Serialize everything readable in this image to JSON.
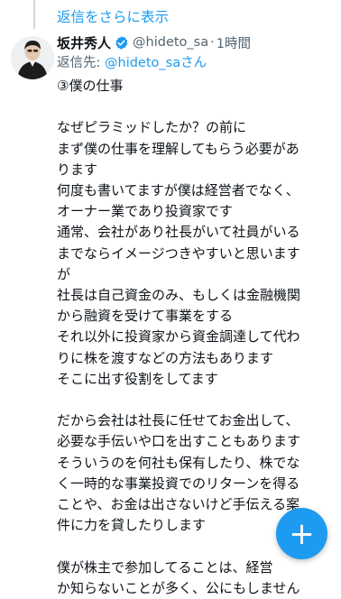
{
  "thread": {
    "show_replies_label": "返信をさらに表示"
  },
  "tweet": {
    "author_name": "坂井秀人",
    "author_handle": "@hideto_sa",
    "separator": "·",
    "timestamp": "1時間",
    "reply_prefix": "返信先: ",
    "reply_mention": "@hideto_saさん",
    "lines": [
      "③僕の仕事",
      "",
      "なぜピラミッドしたか？の前に",
      "まず僕の仕事を理解してもらう必要があ",
      "ります",
      "何度も書いてますが僕は経営者でなく、",
      "オーナー業であり投資家です",
      "通常、会社があり社長がいて社員がいる",
      "までならイメージつきやすいと思います",
      "が",
      "社長は自己資金のみ、もしくは金融機関",
      "から融資を受けて事業をする",
      "それ以外に投資家から資金調達して代わ",
      "りに株を渡すなどの方法もあります",
      "そこに出す役割をしてます",
      "",
      "だから会社は社長に任せてお金出して、",
      "必要な手伝いや口を出すこともあります",
      "そういうのを何社も保有したり、株でな",
      "く一時的な事業投資でのリターンを得る",
      "ことや、お金は出さないけど手伝える案",
      "件に力を貸したりします",
      "",
      "僕が株主で参加してることは、経営",
      "か知らないことが多く、公にもしません"
    ]
  },
  "compose_button": {
    "icon": "plus-icon",
    "symbol": "+"
  },
  "colors": {
    "accent": "#1d9bf0",
    "text": "#0f1419",
    "secondary": "#536471",
    "thread_line": "#cfd9de"
  }
}
